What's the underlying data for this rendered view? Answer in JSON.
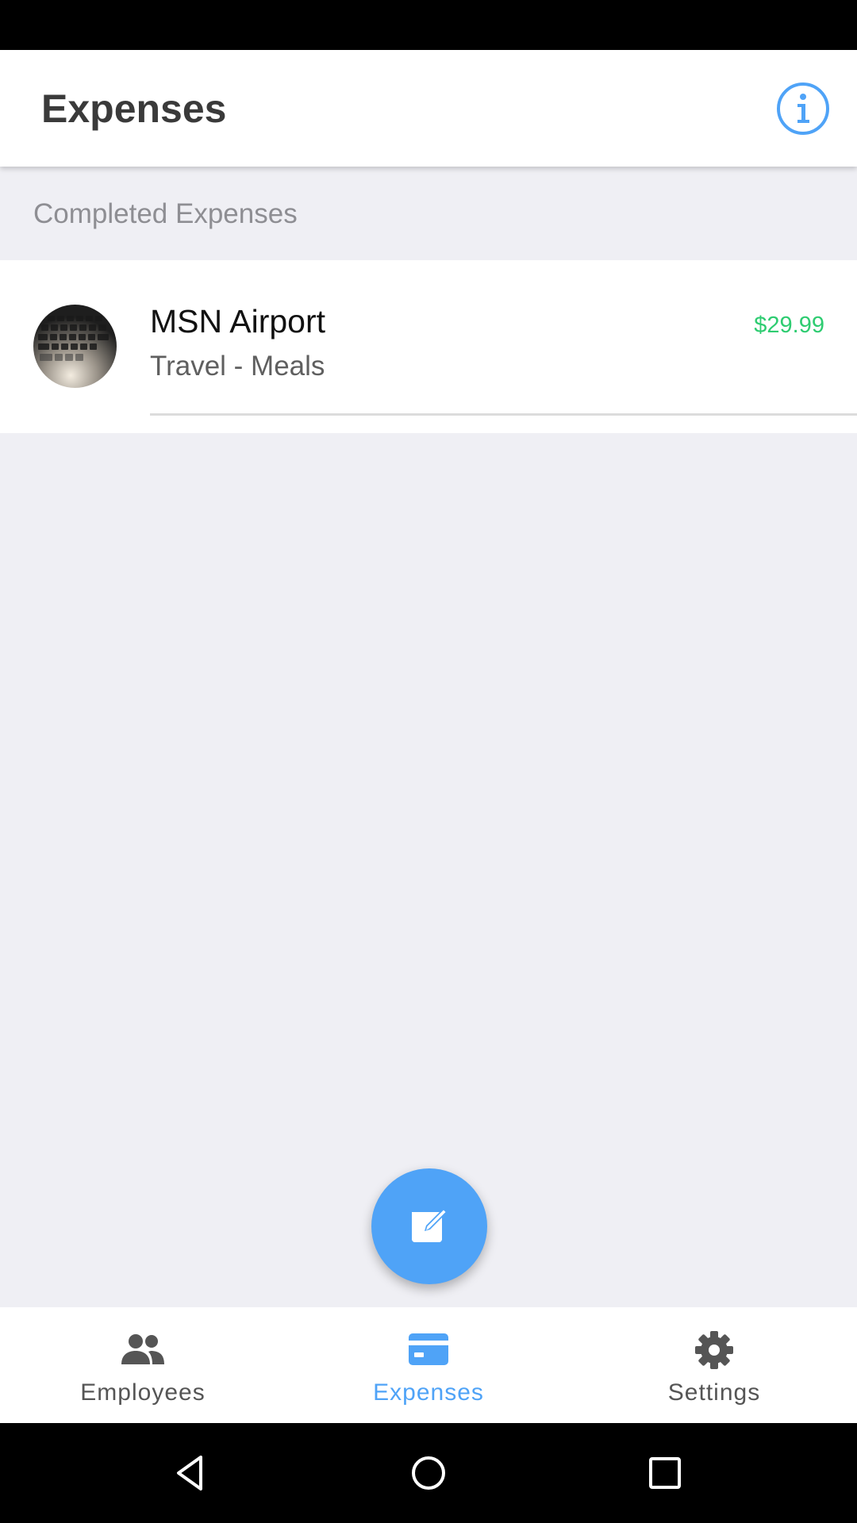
{
  "header": {
    "title": "Expenses",
    "info_icon": "info-circle-icon"
  },
  "section": {
    "title": "Completed Expenses"
  },
  "expenses": [
    {
      "title": "MSN Airport",
      "subtitle": "Travel - Meals",
      "amount": "$29.99",
      "thumbnail": "keyboard-photo"
    }
  ],
  "fab": {
    "icon": "edit-icon"
  },
  "tabs": [
    {
      "label": "Employees",
      "icon": "people-icon",
      "active": false
    },
    {
      "label": "Expenses",
      "icon": "credit-card-icon",
      "active": true
    },
    {
      "label": "Settings",
      "icon": "gear-icon",
      "active": false
    }
  ],
  "system_nav": {
    "back": "back-triangle-icon",
    "home": "home-circle-icon",
    "recents": "recents-square-icon"
  },
  "colors": {
    "accent": "#4fa3f7",
    "amount": "#2ecc71",
    "background": "#efeff4"
  }
}
